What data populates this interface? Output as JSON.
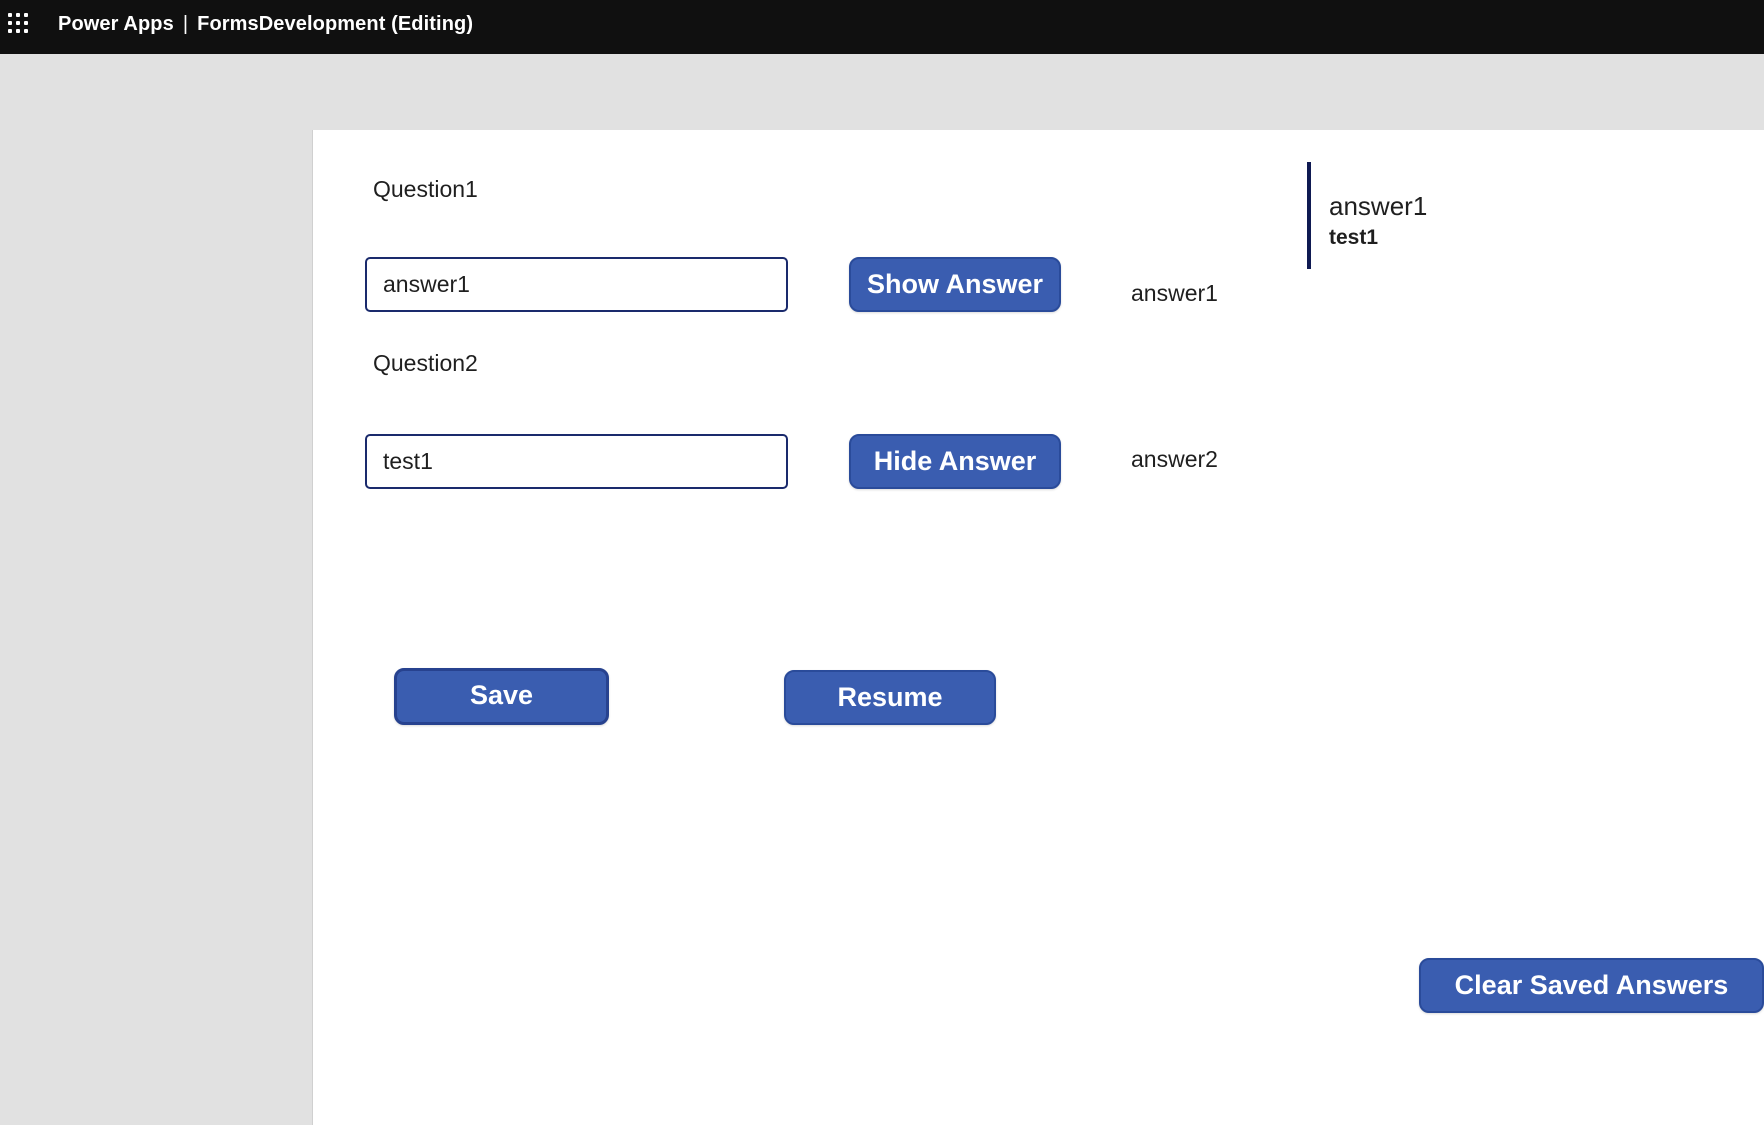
{
  "header": {
    "app_name": "Power Apps",
    "separator": "|",
    "document_title": "FormsDevelopment (Editing)"
  },
  "icons": {
    "app_launcher": "waffle-grid-icon"
  },
  "colors": {
    "top_bar": "#101010",
    "button": "#3a5db0",
    "input_border": "#1a2a6c",
    "saved_panel_accent": "#0f1a52"
  },
  "form": {
    "question1": {
      "label": "Question1",
      "value": "answer1",
      "button_label": "Show Answer",
      "answer_text": "answer1"
    },
    "question2": {
      "label": "Question2",
      "value": "test1",
      "button_label": "Hide Answer",
      "answer_text": "answer2"
    }
  },
  "actions": {
    "save_label": "Save",
    "resume_label": "Resume",
    "clear_label": "Clear Saved Answers"
  },
  "saved_answers": {
    "line1": "answer1",
    "line2": "test1"
  }
}
